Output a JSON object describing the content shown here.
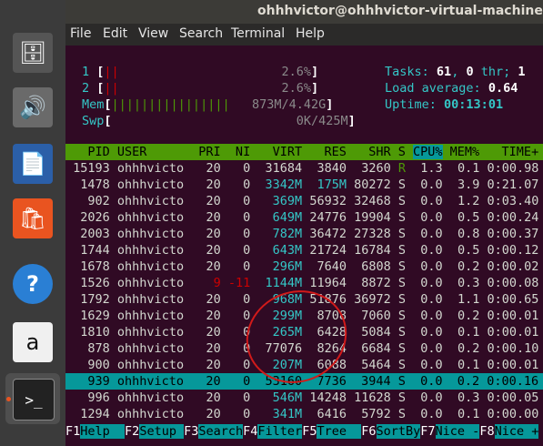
{
  "window": {
    "title": "ohhhvictor@ohhhvictor-virtual-machine: ~"
  },
  "menu": [
    "File",
    "Edit",
    "View",
    "Search",
    "Terminal",
    "Help"
  ],
  "launcher": [
    {
      "name": "files-icon",
      "glyph": "🗄"
    },
    {
      "name": "rhythmbox-icon",
      "glyph": "🔊"
    },
    {
      "name": "libreoffice-writer-icon",
      "glyph": "📄"
    },
    {
      "name": "software-center-icon",
      "glyph": "🛍"
    },
    {
      "name": "help-icon",
      "glyph": "?"
    },
    {
      "name": "amazon-icon",
      "glyph": "a"
    },
    {
      "name": "terminal-icon",
      "glyph": ">_"
    }
  ],
  "meters": {
    "cpu1": {
      "label": "1",
      "bar": "||",
      "value": "2.6%"
    },
    "cpu2": {
      "label": "2",
      "bar": "||",
      "value": "2.6%"
    },
    "mem": {
      "label": "Mem",
      "bar": "||||||||||||||||",
      "value": "873M/4.42G"
    },
    "swp": {
      "label": "Swp",
      "bar": "",
      "value": "0K/425M"
    }
  },
  "summary": {
    "tasks_label": "Tasks:",
    "tasks": "61",
    "thr_sep": ",",
    "thr": "0",
    "thr_label": "thr;",
    "running": "1",
    "load_label": "Load average:",
    "load": "0.64",
    "uptime_label": "Uptime:",
    "uptime": "00:13:01"
  },
  "header": [
    "PID",
    "USER",
    "PRI",
    "NI",
    "VIRT",
    "RES",
    "SHR",
    "S",
    "CPU%",
    "MEM%",
    "TIME+"
  ],
  "processes": [
    [
      "15193",
      "ohhhvicto",
      "20",
      "0",
      "31684",
      "3840",
      "3260",
      "R",
      "1.3",
      "0.1",
      "0:00.98"
    ],
    [
      "1478",
      "ohhhvicto",
      "20",
      "0",
      "3342M",
      "175M",
      "80272",
      "S",
      "0.0",
      "3.9",
      "0:21.07"
    ],
    [
      "902",
      "ohhhvicto",
      "20",
      "0",
      "369M",
      "56932",
      "32468",
      "S",
      "0.0",
      "1.2",
      "0:03.40"
    ],
    [
      "2026",
      "ohhhvicto",
      "20",
      "0",
      "649M",
      "24776",
      "19904",
      "S",
      "0.0",
      "0.5",
      "0:00.24"
    ],
    [
      "2003",
      "ohhhvicto",
      "20",
      "0",
      "782M",
      "36472",
      "27328",
      "S",
      "0.0",
      "0.8",
      "0:00.37"
    ],
    [
      "1744",
      "ohhhvicto",
      "20",
      "0",
      "643M",
      "21724",
      "16784",
      "S",
      "0.0",
      "0.5",
      "0:00.12"
    ],
    [
      "1678",
      "ohhhvicto",
      "20",
      "0",
      "296M",
      "7640",
      "6808",
      "S",
      "0.0",
      "0.2",
      "0:00.02"
    ],
    [
      "1526",
      "ohhhvicto",
      "9",
      "-11",
      "1144M",
      "11964",
      "8872",
      "S",
      "0.0",
      "0.3",
      "0:00.08"
    ],
    [
      "1792",
      "ohhhvicto",
      "20",
      "0",
      "968M",
      "51876",
      "36972",
      "S",
      "0.0",
      "1.1",
      "0:00.65"
    ],
    [
      "1629",
      "ohhhvicto",
      "20",
      "0",
      "299M",
      "8708",
      "7060",
      "S",
      "0.0",
      "0.2",
      "0:00.01"
    ],
    [
      "1810",
      "ohhhvicto",
      "20",
      "0",
      "265M",
      "6428",
      "5084",
      "S",
      "0.0",
      "0.1",
      "0:00.01"
    ],
    [
      "878",
      "ohhhvicto",
      "20",
      "0",
      "77076",
      "8264",
      "6684",
      "S",
      "0.0",
      "0.2",
      "0:00.10"
    ],
    [
      "900",
      "ohhhvicto",
      "20",
      "0",
      "207M",
      "6088",
      "5464",
      "S",
      "0.0",
      "0.1",
      "0:00.01"
    ],
    [
      "939",
      "ohhhvicto",
      "20",
      "0",
      "53160",
      "7736",
      "3944",
      "S",
      "0.0",
      "0.2",
      "0:00.16"
    ],
    [
      "996",
      "ohhhvicto",
      "20",
      "0",
      "546M",
      "14248",
      "11628",
      "S",
      "0.0",
      "0.3",
      "0:00.05"
    ],
    [
      "1294",
      "ohhhvicto",
      "20",
      "0",
      "341M",
      "6416",
      "5792",
      "S",
      "0.0",
      "0.1",
      "0:00.00"
    ]
  ],
  "selected_row": 13,
  "fkeys": [
    {
      "key": "F1",
      "label": "Help  "
    },
    {
      "key": "F2",
      "label": "Setup "
    },
    {
      "key": "F3",
      "label": "Search"
    },
    {
      "key": "F4",
      "label": "Filter"
    },
    {
      "key": "F5",
      "label": "Tree  "
    },
    {
      "key": "F6",
      "label": "SortBy"
    },
    {
      "key": "F7",
      "label": "Nice -"
    },
    {
      "key": "F8",
      "label": "Nice +"
    }
  ],
  "colors": {
    "accent": "#06989a",
    "header": "#4e9a06",
    "bg": "#300a24",
    "annotation": "#d11a1a"
  }
}
